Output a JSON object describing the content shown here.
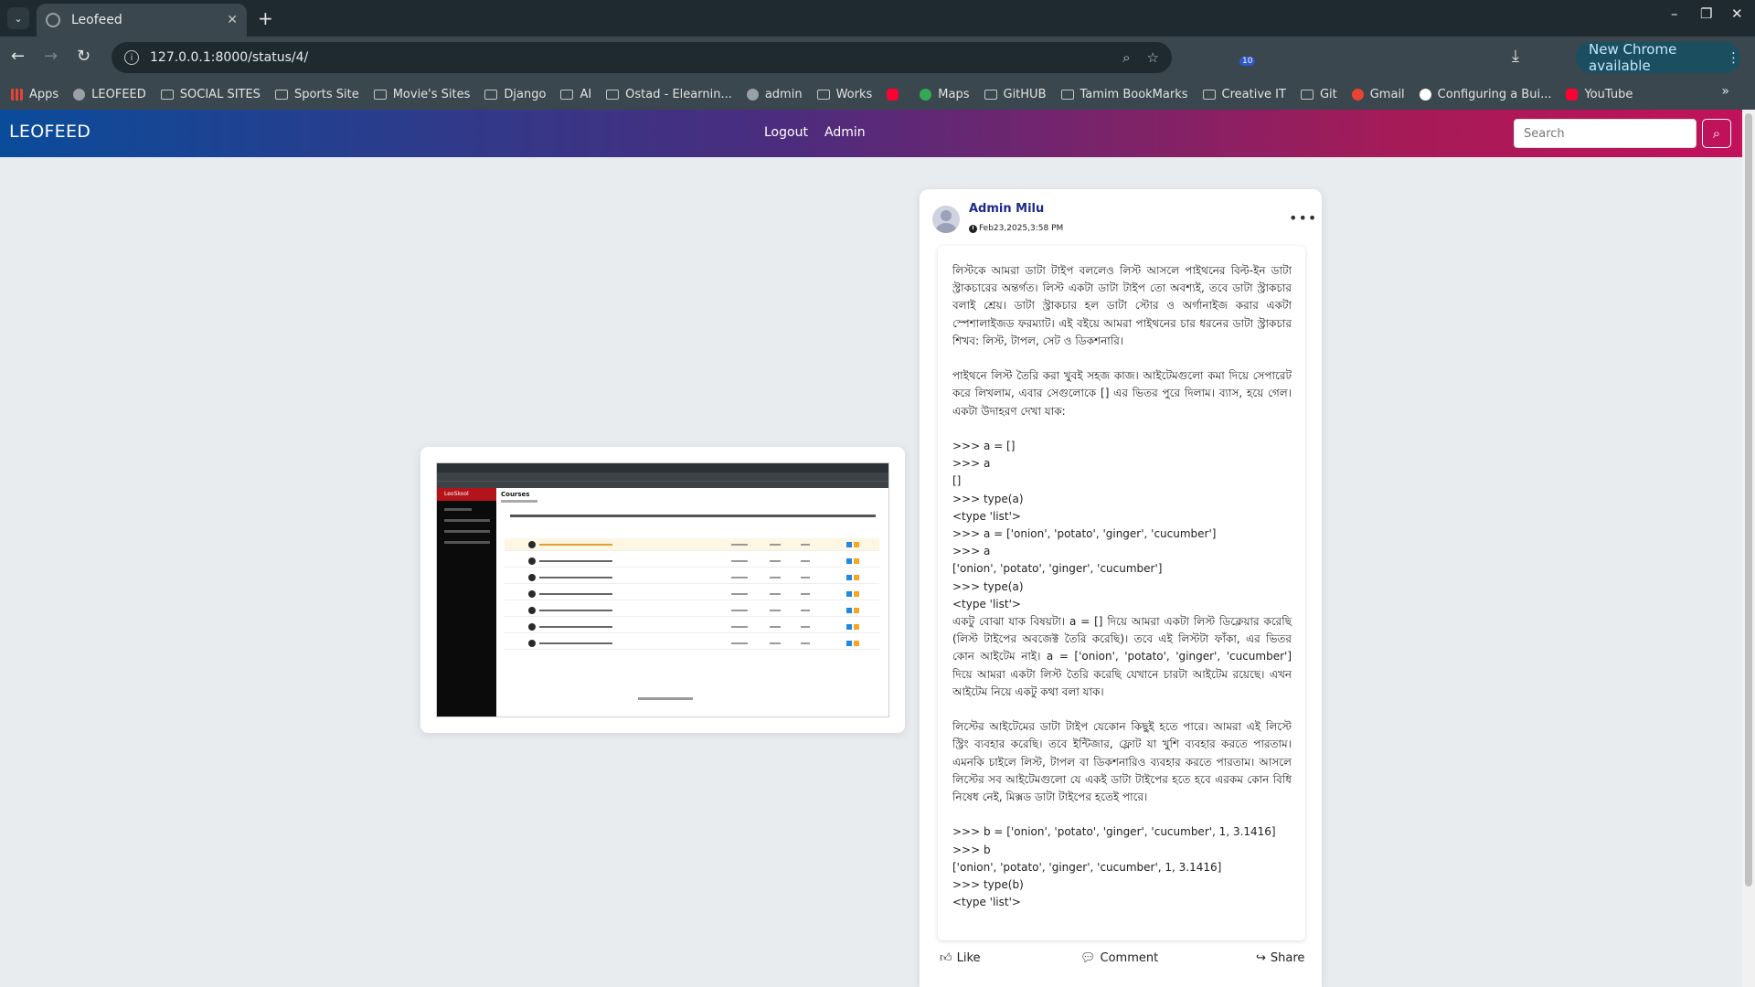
{
  "browser": {
    "tab_title": "Leofeed",
    "url": "127.0.0.1:8000/status/4/",
    "new_chrome_label": "New Chrome available",
    "extension_badge": "10",
    "bookmarks": [
      {
        "label": "Apps",
        "icon": "apps-icon"
      },
      {
        "label": "LEOFEED",
        "icon": "globe-icon"
      },
      {
        "label": "SOCIAL SITES",
        "icon": "folder-icon"
      },
      {
        "label": "Sports Site",
        "icon": "folder-icon"
      },
      {
        "label": "Movie's Sites",
        "icon": "folder-icon"
      },
      {
        "label": "Django",
        "icon": "folder-icon"
      },
      {
        "label": "AI",
        "icon": "folder-icon"
      },
      {
        "label": "Ostad - Elearnin...",
        "icon": "folder-icon"
      },
      {
        "label": "admin",
        "icon": "globe-icon"
      },
      {
        "label": "Works",
        "icon": "folder-icon"
      },
      {
        "label": "",
        "icon": "youtube-icon"
      },
      {
        "label": "Maps",
        "icon": "maps-icon"
      },
      {
        "label": "GitHUB",
        "icon": "folder-icon"
      },
      {
        "label": "Tamim BookMarks",
        "icon": "folder-icon"
      },
      {
        "label": "Creative IT",
        "icon": "folder-icon"
      },
      {
        "label": "Git",
        "icon": "folder-icon"
      },
      {
        "label": "Gmail",
        "icon": "gmail-icon"
      },
      {
        "label": "Configuring a Bui...",
        "icon": "bookmark-icon"
      },
      {
        "label": "YouTube",
        "icon": "youtube-icon"
      }
    ]
  },
  "site": {
    "brand": "LEOFEED",
    "nav": {
      "logout": "Logout",
      "admin": "Admin"
    },
    "search_placeholder": "Search"
  },
  "post": {
    "author": "Admin Milu",
    "date": "Feb23,2025,3:58 PM",
    "para1": "লিস্টকে আমরা ডাটা টাইপ বললেও লিস্ট আসলে পাইথনের বিল্ট-ইন ডাটা স্ট্রাকচারের অন্তর্গত। লিস্ট একটা ডাটা টাইপ তো অবশ্যই, তবে ডাটা স্ট্রাকচার বলাই শ্রেয়। ডাটা স্ট্রাকচার হল ডাটা স্টোর ও অর্গানাইজ করার একটা স্পেশালাইজড ফরম্যাট। এই বইয়ে আমরা পাইথনের চার ধরনের ডাটা স্ট্রাকচার শিখব: লিস্ট, টাপল, সেট ও ডিকশনারি।",
    "para2": "পাইথনে লিস্ট তৈরি করা খুবই সহজ কাজ। আইটেমগুলো কমা দিয়ে সেপারেট করে লিখলাম, এবার সেগুলোকে [] এর ভিতর পুরে দিলাম। ব্যাস, হয়ে গেল। একটা উদাহরণ দেখা যাক:",
    "code1": [
      ">>> a = []",
      ">>> a",
      "[]",
      ">>> type(a)",
      "<type 'list'>",
      ">>> a = ['onion', 'potato', 'ginger', 'cucumber']",
      ">>> a",
      "['onion', 'potato', 'ginger', 'cucumber']",
      ">>> type(a)",
      "<type 'list'>"
    ],
    "para3": "একটু বোঝা যাক বিষয়টা। a = [] দিয়ে আমরা একটা লিস্ট ডিক্লেয়ার করেছি (লিস্ট টাইপের অবজেক্ট তৈরি করেছি)। তবে এই লিস্টটা ফাঁকা, এর ভিতর কোন আইটেম নাই। a = ['onion', 'potato', 'ginger', 'cucumber'] দিয়ে আমরা একটা লিস্ট তৈরি করেছি যেখানে চারটা আইটেম রয়েছে। এখন আইটেম নিয়ে একটু কথা বলা যাক।",
    "para4": "লিস্টের আইটেমের ডাটা টাইপ যেকোন কিছুই হতে পারে। আমরা এই লিস্টে স্ট্রিং ব্যবহার করেছি। তবে ইন্টিজার, ফ্লোট যা খুশি ব্যবহার করতে পারতাম। এমনকি চাইলে লিস্ট, টাপল বা ডিকশনারিও ব্যবহার করতে পারতাম। আসলে লিস্টের সব আইটেমগুলো যে একই ডাটা টাইপের হতে হবে এরকম কোন বিধি নিষেধ নেই, মিক্সড ডাটা টাইপের হতেই পারে।",
    "code2": [
      ">>> b = ['onion', 'potato', 'ginger', 'cucumber', 1, 3.1416]",
      ">>> b",
      "['onion', 'potato', 'ginger', 'cucumber', 1, 3.1416]",
      ">>> type(b)",
      "<type 'list'>"
    ],
    "actions": {
      "like": "Like",
      "comment": "Comment",
      "share": "Share"
    }
  },
  "image_preview": {
    "logo": "LeoSkool",
    "heading": "Courses"
  },
  "colors": {
    "navbar_start": "#0a4c9a",
    "navbar_end": "#c1125a",
    "author": "#1b2a8c",
    "page_bg": "#e9ecef"
  }
}
